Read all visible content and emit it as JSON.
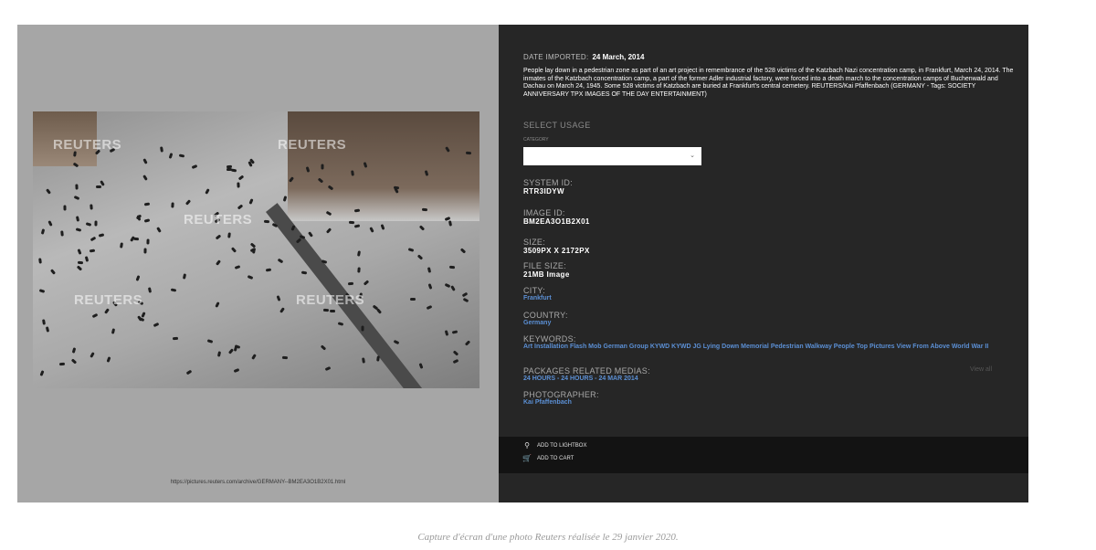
{
  "photo": {
    "watermark": "REUTERS",
    "url": "https://pictures.reuters.com/archive/GERMANY--BM2EA3O1B2X01.html"
  },
  "details": {
    "date_label": "DATE IMPORTED:",
    "date_value": "24 March, 2014",
    "caption": "People lay down in a pedestrian zone as part of an art project in remembrance of the 528 victims of the Katzbach Nazi concentration camp, in Frankfurt, March 24, 2014. The inmates of the Katzbach concentration camp, a part of the former Adler industrial factory, were forced into a death march to the concentration camps of Buchenwald and Dachau on March 24, 1945. Some 528 victims of Katzbach are buried at Frankfurt's central cemetery. REUTERS/Kai Pfaffenbach (GERMANY - Tags: SOCIETY ANNIVERSARY TPX IMAGES OF THE DAY ENTERTAINMENT)",
    "select_usage": "SELECT USAGE",
    "category_label": "CATEGORY",
    "category_value": "",
    "system_id_label": "SYSTEM ID:",
    "system_id_value": "RTR3IDYW",
    "image_id_label": "IMAGE ID:",
    "image_id_value": "BM2EA3O1B2X01",
    "size_label": "SIZE:",
    "size_value": "3509PX X 2172PX",
    "file_size_label": "FILE SIZE:",
    "file_size_value": "21MB Image",
    "city_label": "CITY:",
    "city_value": "Frankfurt",
    "country_label": "COUNTRY:",
    "country_value": "Germany",
    "keywords_label": "KEYWORDS:",
    "keywords_value": "Art Installation Flash Mob German Group KYWD KYWD JG Lying Down Memorial Pedestrian Walkway People Top Pictures View From Above World War II",
    "packages_label": "PACKAGES RELATED MEDIAS:",
    "packages_value": "24 HOURS - 24 HOURS - 24 MAR 2014",
    "view_all": "View all",
    "photographer_label": "PHOTOGRAPHER:",
    "photographer_value": "Kai Pfaffenbach"
  },
  "actions": {
    "lightbox_icon": "pin-icon",
    "lightbox_label": "ADD TO LIGHTBOX",
    "cart_icon": "cart-icon",
    "cart_label": "ADD TO CART"
  },
  "page_caption": "Capture d'écran d'une photo Reuters réalisée le 29 janvier 2020.",
  "colors": {
    "panel_bg": "#262626",
    "link": "#5b8fd4",
    "left_bg": "#a6a6a6"
  }
}
